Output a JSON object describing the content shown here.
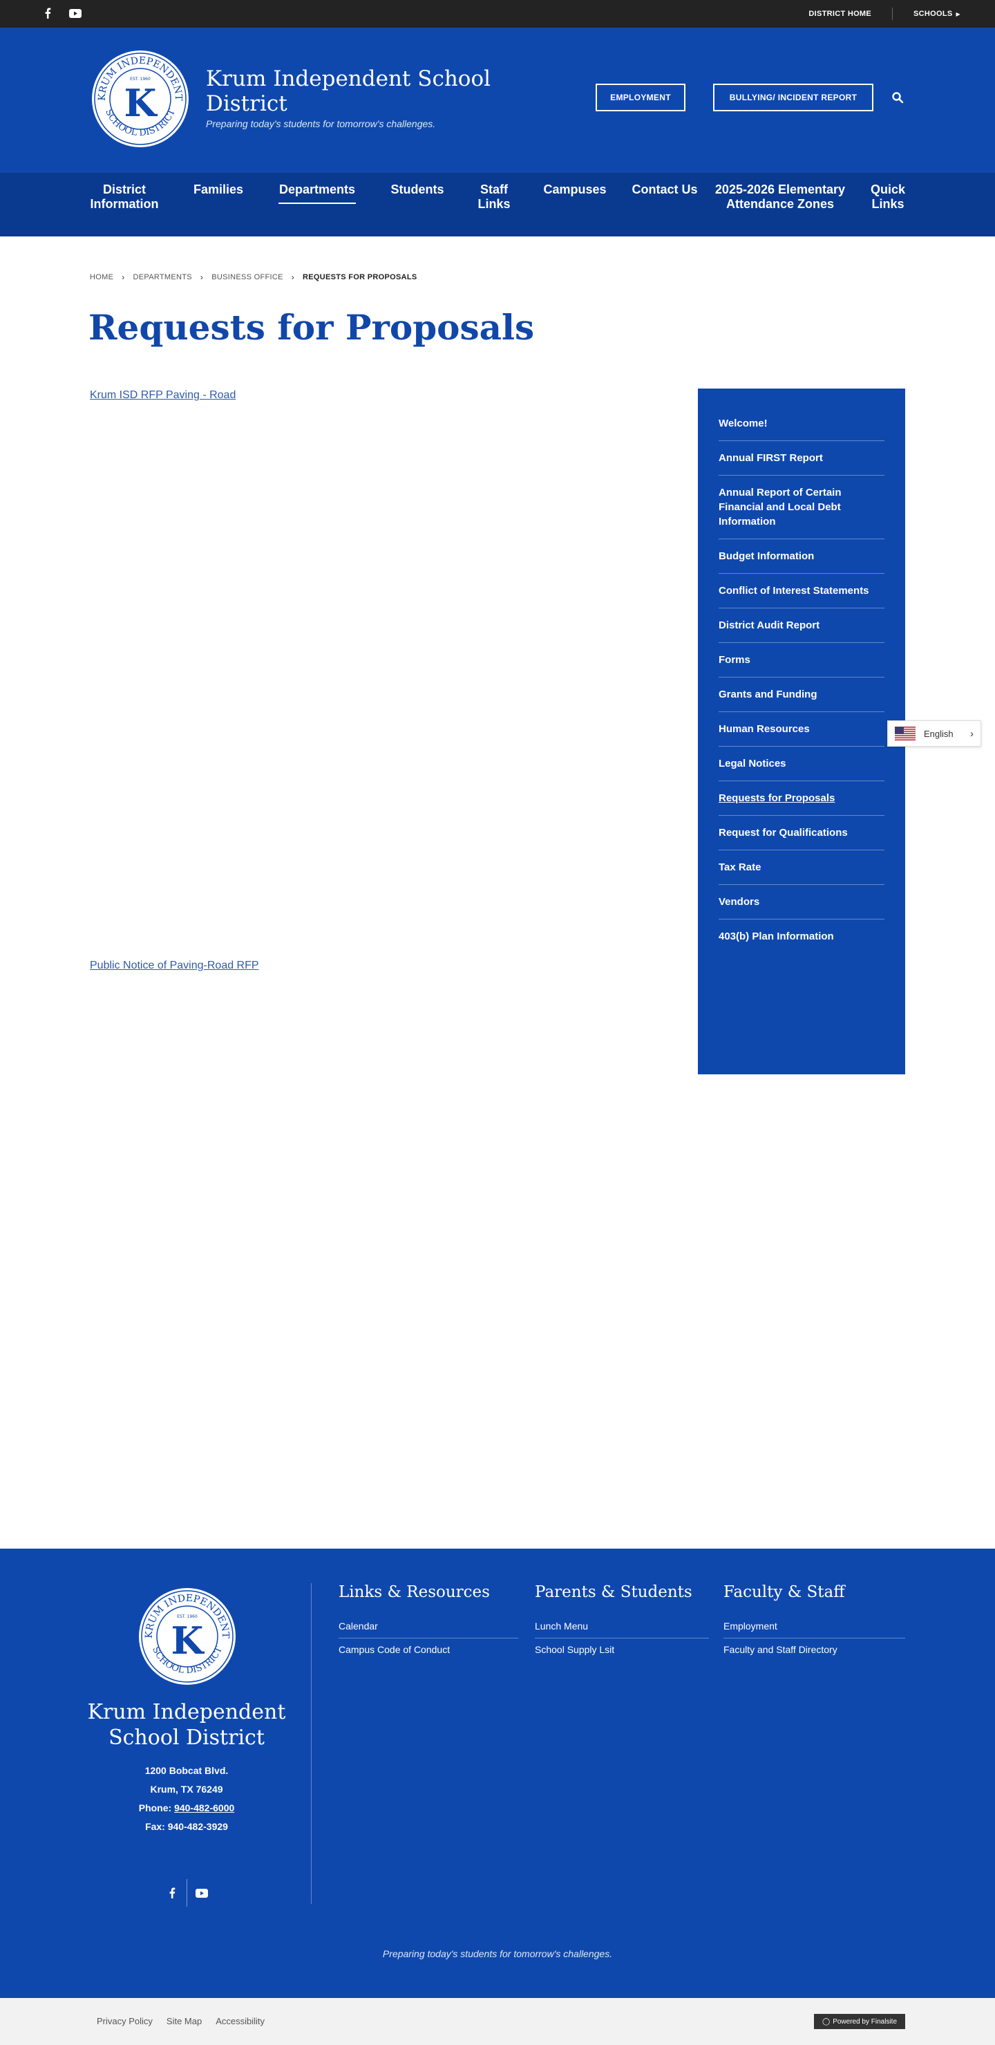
{
  "utility": {
    "district_home": "DISTRICT HOME",
    "schools": "SCHOOLS"
  },
  "header": {
    "title": "Krum Independent School District",
    "tagline": "Preparing today's students for tomorrow's challenges.",
    "employment": "EMPLOYMENT",
    "bullying": "BULLYING/ INCIDENT REPORT",
    "logo_text_top": "KRUM INDEPENDENT",
    "logo_text_bottom": "SCHOOL DISTRICT",
    "logo_est": "EST. 1960",
    "logo_letter": "K"
  },
  "nav": {
    "items": [
      {
        "label": "District Information"
      },
      {
        "label": "Families"
      },
      {
        "label": "Departments"
      },
      {
        "label": "Students"
      },
      {
        "label": "Staff Links"
      },
      {
        "label": "Campuses"
      },
      {
        "label": "Contact Us"
      },
      {
        "label": "2025-2026 Elementary Attendance Zones"
      },
      {
        "label": "Quick Links"
      }
    ]
  },
  "breadcrumb": [
    "HOME",
    "DEPARTMENTS",
    "BUSINESS OFFICE",
    "REQUESTS FOR PROPOSALS"
  ],
  "page": {
    "title": "Requests for Proposals",
    "links": [
      "Krum ISD RFP Paving - Road",
      "Public Notice of Paving-Road RFP"
    ]
  },
  "sidenav": {
    "items": [
      "Welcome!",
      "Annual FIRST Report",
      "Annual Report of Certain Financial and Local Debt Information",
      "Budget Information",
      "Conflict of Interest Statements",
      "District Audit Report",
      "Forms",
      "Grants and Funding",
      "Human Resources",
      "Legal Notices",
      "Requests for Proposals",
      "Request for Qualifications",
      "Tax Rate",
      "Vendors",
      "403(b) Plan Information"
    ]
  },
  "language": {
    "label": "English"
  },
  "footer": {
    "name": "Krum Independent School District",
    "address1": "1200 Bobcat Blvd.",
    "address2": "Krum, TX  76249",
    "phone_label": "Phone: ",
    "phone": "940-482-6000",
    "fax": "Fax: 940-482-3929",
    "tagline": "Preparing today's students for tomorrow's challenges.",
    "columns": [
      {
        "title": "Links & Resources",
        "links": [
          "Calendar",
          "Campus Code of Conduct"
        ]
      },
      {
        "title": "Parents & Students",
        "links": [
          "Lunch Menu",
          "School Supply Lsit"
        ]
      },
      {
        "title": "Faculty & Staff",
        "links": [
          "Employment",
          "Faculty and Staff Directory"
        ]
      }
    ]
  },
  "bottom": {
    "links": [
      "Privacy Policy",
      "Site Map",
      "Accessibility"
    ],
    "powered": "Powered by Finalsite"
  },
  "colors": {
    "primary": "#0f48ad",
    "nav": "#0a3a8f",
    "utility": "#232323"
  }
}
